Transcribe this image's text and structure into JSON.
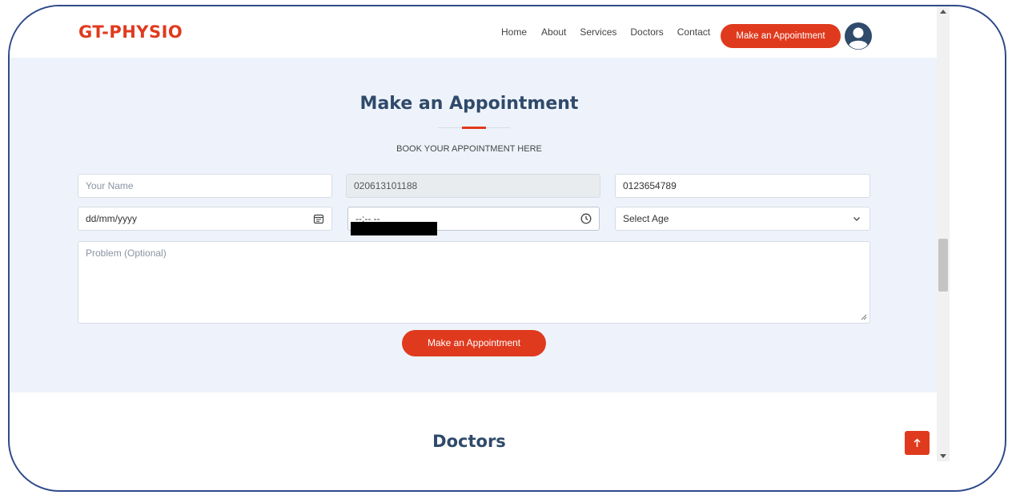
{
  "colors": {
    "accent": "#e03a1e",
    "heading": "#2f4a6a",
    "section_bg": "#eef3fb",
    "frame": "#2f4a8a"
  },
  "header": {
    "logo": "GT-PHYSIO",
    "nav": [
      "Home",
      "About",
      "Services",
      "Doctors",
      "Contact"
    ],
    "cta_label": "Make an Appointment",
    "avatar_icon": "user-avatar-icon"
  },
  "appointment": {
    "title": "Make an Appointment",
    "subtitle": "BOOK YOUR APPOINTMENT HERE",
    "name_placeholder": "Your Name",
    "phone_value": "020613101188",
    "second_phone_value": "0123654789",
    "date_placeholder": "dd/mm/yyyy",
    "time_placeholder": "--:-- --",
    "age_placeholder": "Select Age",
    "problem_placeholder": "Problem (Optional)",
    "submit_label": "Make an Appointment"
  },
  "doctors": {
    "title": "Doctors"
  },
  "back_to_top_icon": "arrow-up-icon"
}
